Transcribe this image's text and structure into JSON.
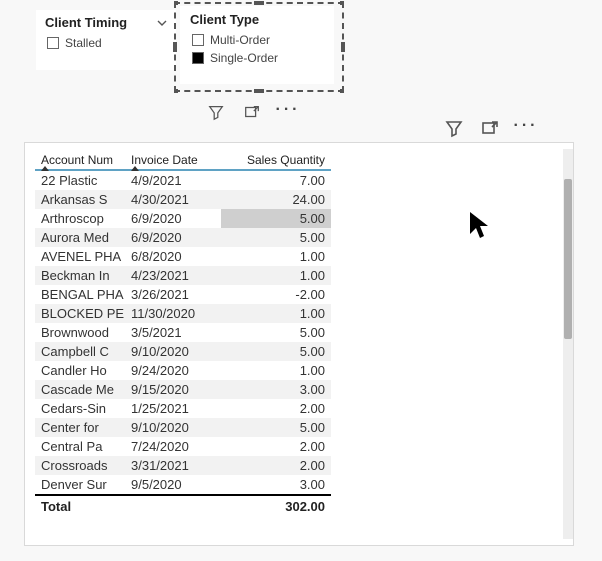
{
  "slicers": {
    "timing": {
      "title": "Client Timing",
      "items": [
        {
          "label": "Stalled",
          "checked": false
        }
      ]
    },
    "type": {
      "title": "Client Type",
      "items": [
        {
          "label": "Multi-Order",
          "checked": false
        },
        {
          "label": "Single-Order",
          "checked": true
        }
      ]
    }
  },
  "table": {
    "columns": [
      "Account Num",
      "Invoice Date",
      "Sales Quantity"
    ],
    "rows": [
      {
        "acct": "22 Plastic",
        "date": "4/9/2021",
        "qty": "7.00"
      },
      {
        "acct": "Arkansas S",
        "date": "4/30/2021",
        "qty": "24.00"
      },
      {
        "acct": "Arthroscop",
        "date": "6/9/2020",
        "qty": "5.00",
        "hilite": true
      },
      {
        "acct": "Aurora Med",
        "date": "6/9/2020",
        "qty": "5.00"
      },
      {
        "acct": "AVENEL PHA",
        "date": "6/8/2020",
        "qty": "1.00"
      },
      {
        "acct": "Beckman In",
        "date": "4/23/2021",
        "qty": "1.00"
      },
      {
        "acct": "BENGAL PHA",
        "date": "3/26/2021",
        "qty": "-2.00"
      },
      {
        "acct": "BLOCKED PE",
        "date": "11/30/2020",
        "qty": "1.00"
      },
      {
        "acct": "Brownwood",
        "date": "3/5/2021",
        "qty": "5.00"
      },
      {
        "acct": "Campbell C",
        "date": "9/10/2020",
        "qty": "5.00"
      },
      {
        "acct": "Candler Ho",
        "date": "9/24/2020",
        "qty": "1.00"
      },
      {
        "acct": "Cascade Me",
        "date": "9/15/2020",
        "qty": "3.00"
      },
      {
        "acct": "Cedars-Sin",
        "date": "1/25/2021",
        "qty": "2.00"
      },
      {
        "acct": "Center for",
        "date": "9/10/2020",
        "qty": "5.00"
      },
      {
        "acct": "Central Pa",
        "date": "7/24/2020",
        "qty": "2.00"
      },
      {
        "acct": "Crossroads",
        "date": "3/31/2021",
        "qty": "2.00"
      },
      {
        "acct": "Denver Sur",
        "date": "9/5/2020",
        "qty": "3.00"
      }
    ],
    "total_label": "Total",
    "total_value": "302.00"
  }
}
